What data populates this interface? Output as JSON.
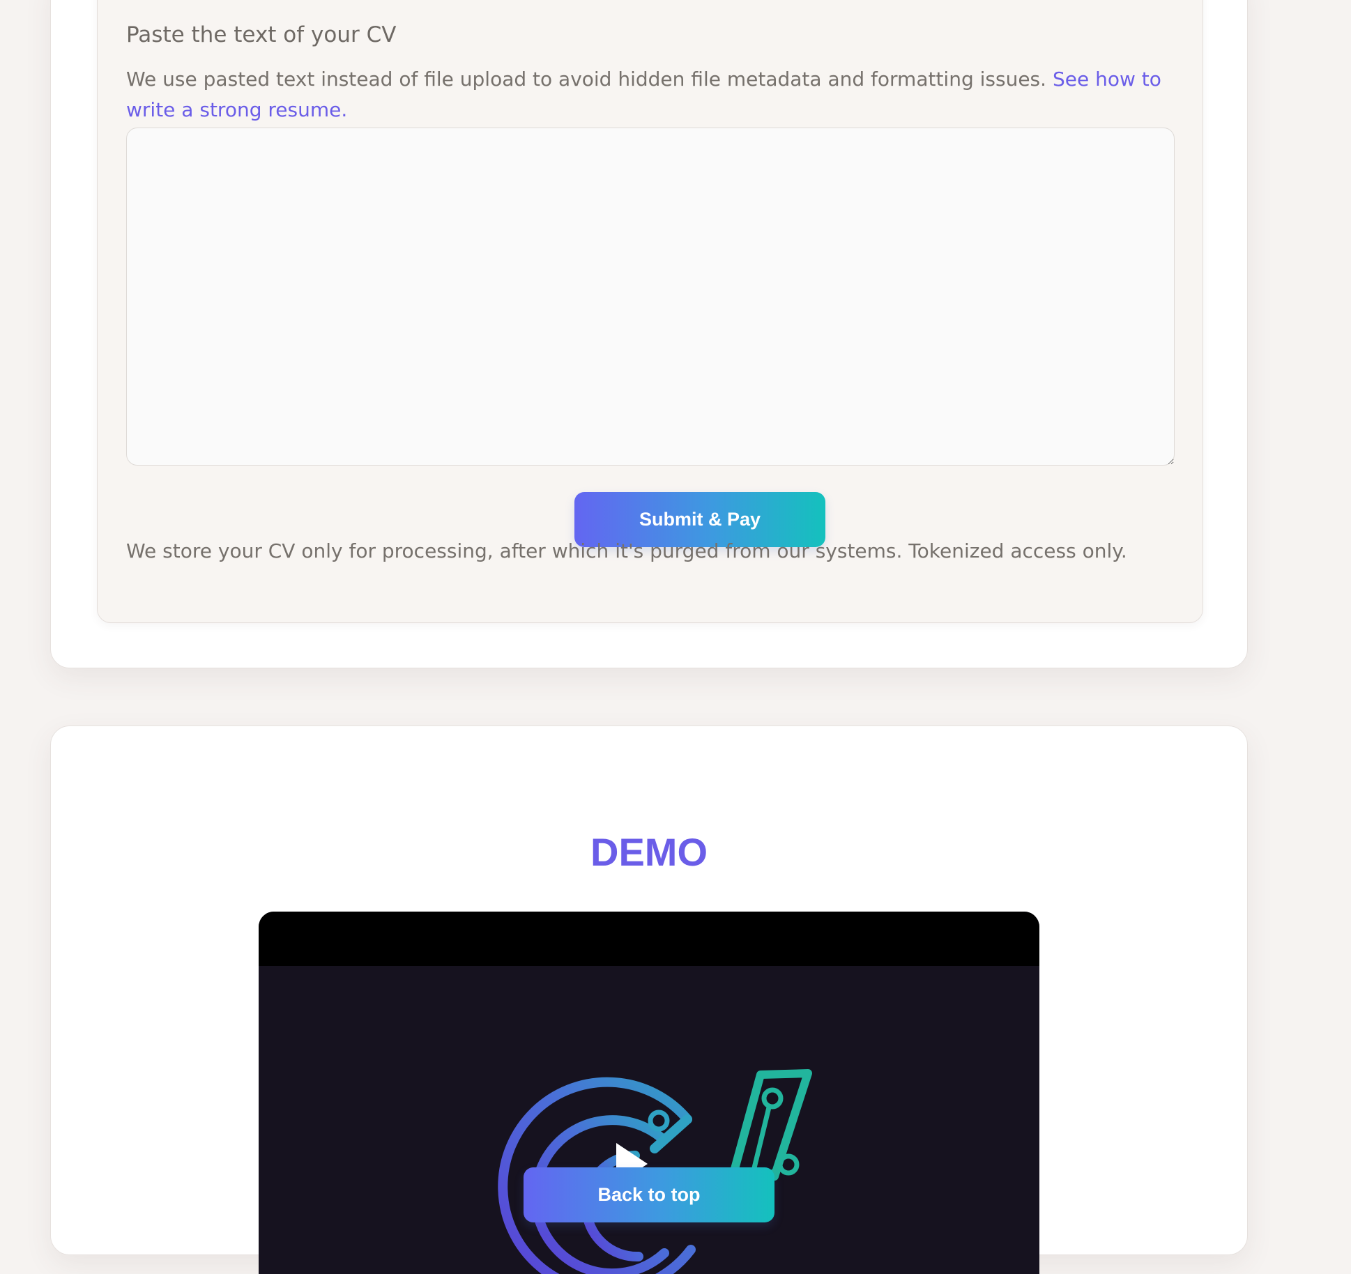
{
  "form": {
    "title": "Paste the text of your CV",
    "description": "We use pasted text instead of file upload to avoid hidden file metadata and formatting issues.",
    "description_link": "See how to write a strong resume.",
    "textarea_value": "",
    "submit_label": "Submit & Pay",
    "privacy_note": "We store your CV only for processing, after which it's purged from our systems. Tokenized access only."
  },
  "demo": {
    "title": "DEMO"
  },
  "back_to_top_label": "Back to top",
  "colors": {
    "accent": "#6a5de8",
    "gradient_start": "#6366f1",
    "gradient_end": "#14c1bd",
    "video_bg": "#16121f"
  },
  "icons": [
    "play-icon",
    "cv-logo-icon"
  ]
}
